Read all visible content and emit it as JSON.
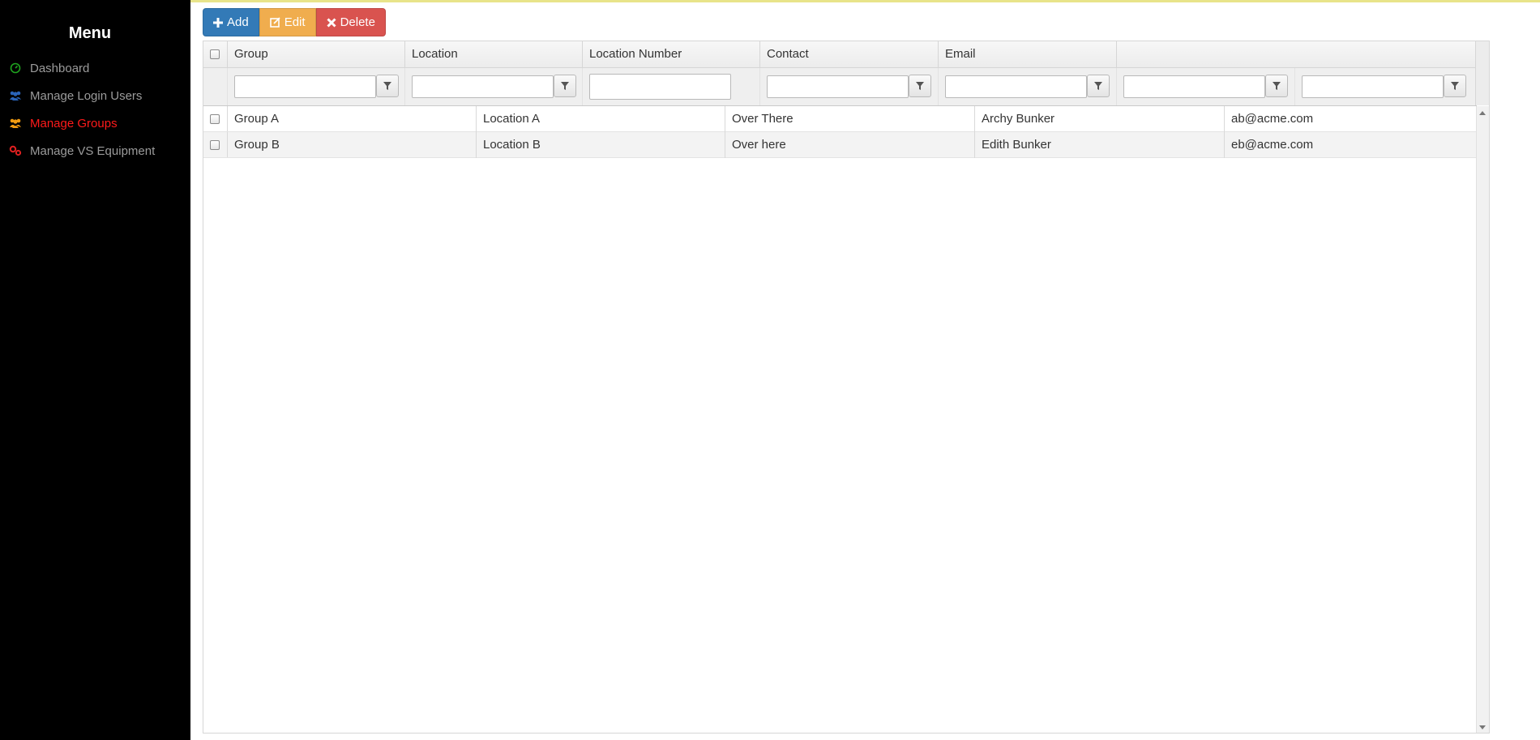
{
  "sidebar": {
    "title": "Menu",
    "items": [
      {
        "label": "Dashboard",
        "icon": "dashboard-icon",
        "color": "#1fa31f",
        "active": false
      },
      {
        "label": "Manage Login Users",
        "icon": "users-icon",
        "color": "#2a63b8",
        "active": false
      },
      {
        "label": "Manage Groups",
        "icon": "groups-icon",
        "color": "#f39c12",
        "active": true
      },
      {
        "label": "Manage VS Equipment",
        "icon": "equipment-icon",
        "color": "#e02020",
        "active": false
      }
    ]
  },
  "toolbar": {
    "add_label": "Add",
    "edit_label": "Edit",
    "delete_label": "Delete"
  },
  "grid": {
    "columns": [
      "Group",
      "Location",
      "Location Number",
      "Contact",
      "Email"
    ],
    "rows": [
      [
        "Group A",
        "Location A",
        "Over There",
        "Archy Bunker",
        "ab@acme.com"
      ],
      [
        "Group B",
        "Location B",
        "Over here",
        "Edith Bunker",
        "eb@acme.com"
      ]
    ]
  },
  "colors": {
    "sidebar_bg": "#000000",
    "active_item": "#ff1a1a",
    "add_button": "#337ab7",
    "edit_button": "#f0ad4e",
    "delete_button": "#d9534f"
  }
}
